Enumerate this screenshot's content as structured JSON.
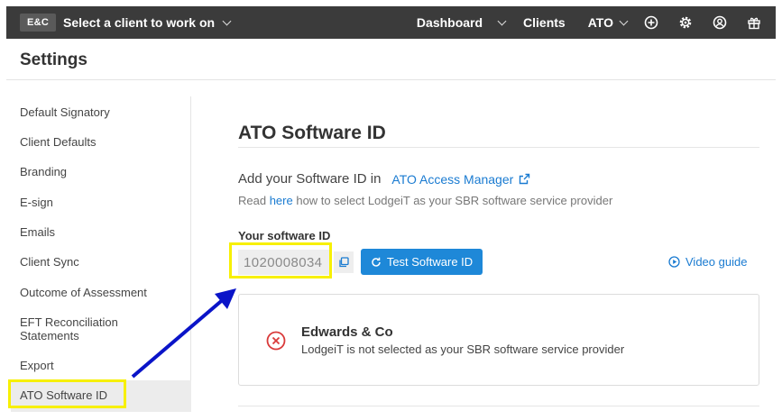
{
  "topbar": {
    "brand": "E&C",
    "client_select": "Select a client to work on",
    "dashboard": "Dashboard",
    "clients": "Clients",
    "ato": "ATO"
  },
  "settings": {
    "title": "Settings"
  },
  "sidebar": {
    "items": [
      {
        "label": "Default Signatory"
      },
      {
        "label": "Client Defaults"
      },
      {
        "label": "Branding"
      },
      {
        "label": "E-sign"
      },
      {
        "label": "Emails"
      },
      {
        "label": "Client Sync"
      },
      {
        "label": "Outcome of Assessment"
      },
      {
        "label": "EFT Reconciliation Statements"
      },
      {
        "label": "Export"
      },
      {
        "label": "ATO Software ID"
      }
    ],
    "active": "ATO Software ID"
  },
  "main": {
    "title": "ATO Software ID",
    "add_text": "Add your Software ID in",
    "ato_link": "ATO Access Manager",
    "read_prefix": "Read ",
    "read_here": "here",
    "read_suffix": " how to select LodgeiT as your SBR software service provider",
    "software_id_label": "Your software ID",
    "software_id": "1020008034",
    "test_button": "Test Software ID",
    "video_guide": "Video guide"
  },
  "alert": {
    "title": "Edwards & Co",
    "message": "LodgeiT is not selected as your SBR software service provider",
    "status_color": "#d93a3a"
  },
  "colors": {
    "accent": "#1e88d8",
    "highlight": "#f7f000",
    "annotation_arrow": "#0a14c8",
    "topbar": "#3b3b3b"
  },
  "icons": {
    "add": "plus-circle-icon",
    "settings": "gear-icon",
    "profile": "user-circle-icon",
    "gift": "gift-icon",
    "copy": "copy-icon",
    "refresh": "refresh-icon",
    "play": "play-circle-icon",
    "error": "x-circle-icon",
    "external": "external-link-icon"
  }
}
